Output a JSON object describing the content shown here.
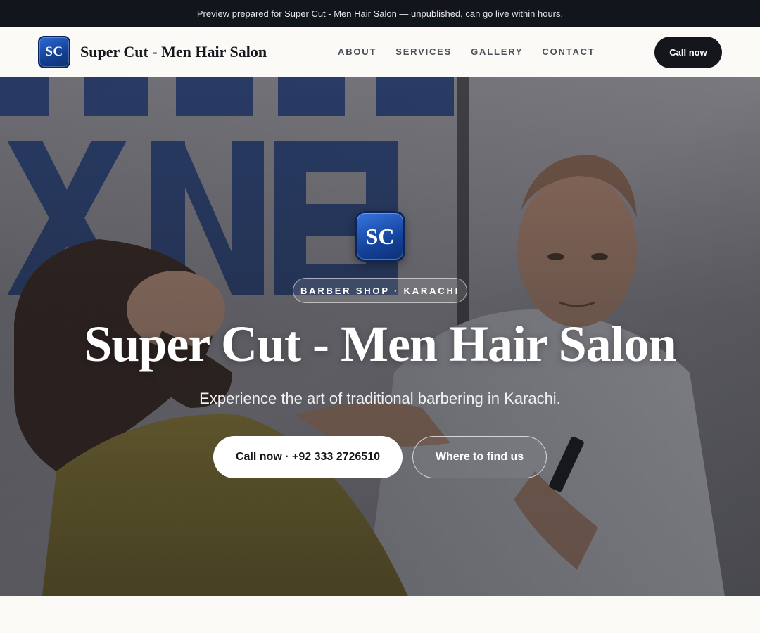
{
  "announcement": "Preview prepared for Super Cut - Men Hair Salon — unpublished, can go live within hours.",
  "nav": {
    "logo_text": "SC",
    "brand": "Super Cut - Men Hair Salon",
    "links": [
      "ABOUT",
      "SERVICES",
      "GALLERY",
      "CONTACT"
    ],
    "cta": "Call now"
  },
  "hero": {
    "logo_text": "SC",
    "eyebrow": "BARBER SHOP · KARACHI",
    "title": "Super Cut - Men Hair Salon",
    "subtitle": "Experience the art of traditional barbering in Karachi.",
    "primary_button": "Call now · +92 333 2726510",
    "secondary_button": "Where to find us"
  },
  "colors": {
    "announcement_bg": "#12151b",
    "nav_bg": "#fbfaf7",
    "brand_blue": "#14439a",
    "dark_button": "#14161b"
  }
}
